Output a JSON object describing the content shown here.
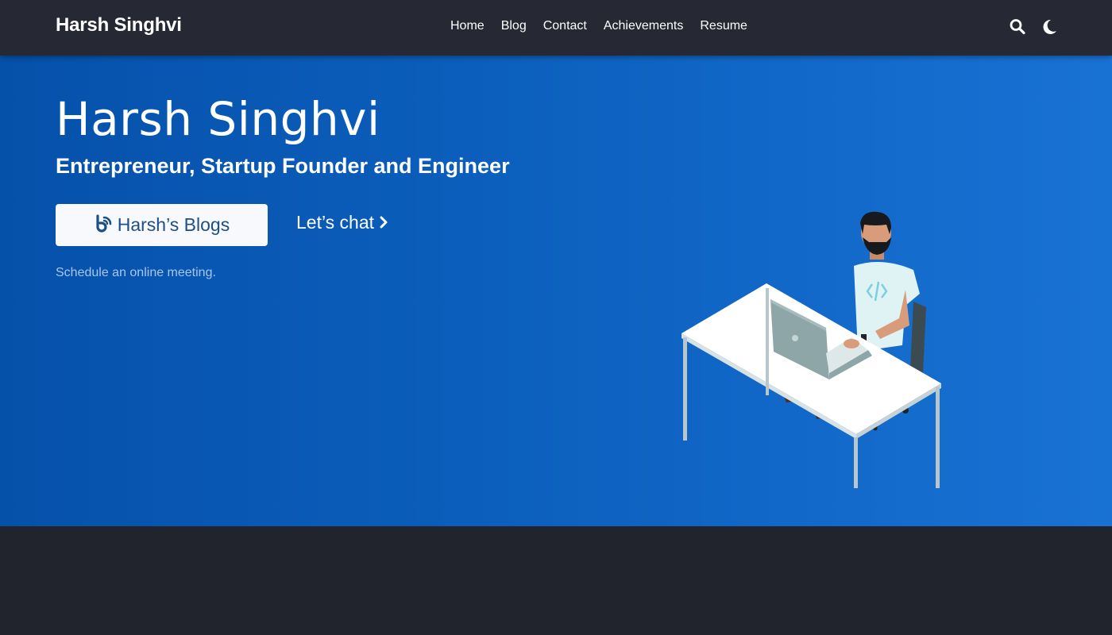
{
  "nav": {
    "brand": "Harsh Singhvi",
    "links": [
      "Home",
      "Blog",
      "Contact",
      "Achievements",
      "Resume"
    ],
    "icons": [
      "search-icon",
      "moon-icon"
    ]
  },
  "hero": {
    "title": "Harsh Singhvi",
    "subtitle": "Entrepreneur, Startup Founder and Engineer",
    "blogs_button": "Harsh’s Blogs",
    "blogs_icon": "blogger-icon",
    "chat_link": "Let’s chat",
    "schedule_link": "Schedule an online meeting."
  },
  "colors": {
    "navbar": "#262833",
    "hero_start": "#0551aa",
    "hero_end": "#1872d4",
    "page_bg": "#21232d",
    "button_text": "#1d4f86"
  }
}
